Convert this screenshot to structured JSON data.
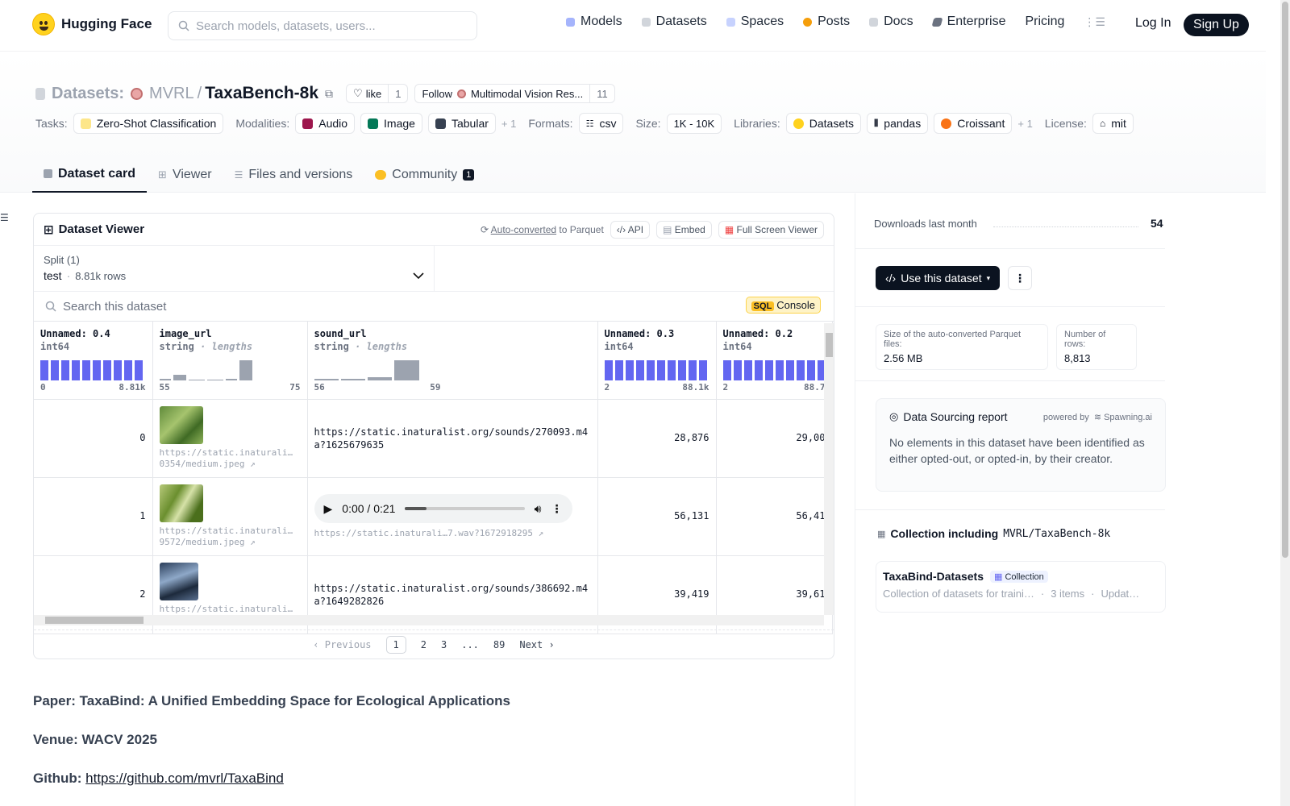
{
  "nav": {
    "brand": "Hugging Face",
    "search_placeholder": "Search models, datasets, users...",
    "items": [
      "Models",
      "Datasets",
      "Spaces",
      "Posts",
      "Docs",
      "Enterprise",
      "Pricing"
    ],
    "login": "Log In",
    "signup": "Sign Up"
  },
  "header": {
    "section": "Datasets:",
    "org": "MVRL",
    "slash": "/",
    "name": "TaxaBench-8k",
    "like_label": "like",
    "like_count": "1",
    "follow_label": "Follow",
    "follow_org": "Multimodal Vision Res...",
    "follow_count": "11",
    "tasks_label": "Tasks:",
    "task": "Zero-Shot Classification",
    "modalities_label": "Modalities:",
    "modalities": [
      "Audio",
      "Image",
      "Tabular"
    ],
    "modalities_more": "+ 1",
    "formats_label": "Formats:",
    "format": "csv",
    "size_label": "Size:",
    "size": "1K - 10K",
    "libraries_label": "Libraries:",
    "libraries": [
      "Datasets",
      "pandas",
      "Croissant"
    ],
    "libraries_more": "+ 1",
    "license_label": "License:",
    "license": "mit"
  },
  "tabs": [
    {
      "label": "Dataset card",
      "active": true
    },
    {
      "label": "Viewer"
    },
    {
      "label": "Files and versions"
    },
    {
      "label": "Community",
      "badge": "1"
    }
  ],
  "viewer": {
    "title": "Dataset Viewer",
    "auto_converted": "Auto-converted",
    "to_parquet": "to Parquet",
    "api": "API",
    "embed": "Embed",
    "full_screen": "Full Screen Viewer",
    "split_label": "Split (1)",
    "split_name": "test",
    "split_dot": "·",
    "split_rows": "8.81k rows",
    "search_placeholder": "Search this dataset",
    "sql": "SQL",
    "console": "Console",
    "columns": [
      {
        "name": "Unnamed: 0.4",
        "type": "int64",
        "min": "0",
        "max": "8.81k"
      },
      {
        "name": "image_url",
        "type": "string",
        "sub": "· lengths",
        "min": "55",
        "max": "75"
      },
      {
        "name": "sound_url",
        "type": "string",
        "sub": "· lengths",
        "min": "56",
        "max": "59"
      },
      {
        "name": "Unnamed: 0.3",
        "type": "int64",
        "min": "2",
        "max": "88.1k"
      },
      {
        "name": "Unnamed: 0.2",
        "type": "int64",
        "min": "2",
        "max": "88.7"
      }
    ],
    "rows": [
      {
        "idx": "0",
        "img_url_a": "https://static.inaturali…",
        "img_url_b": "0354/medium.jpeg ↗",
        "sound": "https://static.inaturalist.org/sounds/270093.m4a?1625679635",
        "c3": "28,876",
        "c4": "29,00"
      },
      {
        "idx": "1",
        "img_url_a": "https://static.inaturali…",
        "img_url_b": "9572/medium.jpeg ↗",
        "audio_time": "0:00 / 0:21",
        "sound_small": "https://static.inaturali…7.wav?1672918295 ↗",
        "c3": "56,131",
        "c4": "56,41"
      },
      {
        "idx": "2",
        "img_url_a": "https://static.inaturali…",
        "img_url_b": "",
        "sound": "https://static.inaturalist.org/sounds/386692.m4a?1649282826",
        "c3": "39,419",
        "c4": "39,61"
      }
    ],
    "pager": {
      "prev": "‹ Previous",
      "pages": [
        "1",
        "2",
        "3",
        "...",
        "89"
      ],
      "next": "Next ›"
    }
  },
  "card": {
    "paper": "Paper: TaxaBind: A Unified Embedding Space for Ecological Applications",
    "venue": "Venue: WACV 2025",
    "github_label": "Github:",
    "github_url": "https://github.com/mvrl/TaxaBind"
  },
  "side": {
    "downloads_label": "Downloads last month",
    "downloads": "54",
    "use_dataset": "Use this dataset",
    "parquet_label": "Size of the auto-converted Parquet files:",
    "parquet_value": "2.56 MB",
    "rows_label": "Number of rows:",
    "rows_value": "8,813",
    "sourcing_title": "Data Sourcing report",
    "powered_by": "powered by",
    "spawning": "Spawning.ai",
    "sourcing_text": "No elements in this dataset have been identified as either opted-out, or opted-in, by their creator.",
    "collection_prefix": "Collection including",
    "collection_repo": "MVRL/TaxaBench-8k",
    "collection_name": "TaxaBind-Datasets",
    "collection_badge": "Collection",
    "collection_desc": "Collection of datasets for traini…",
    "collection_items": "3 items",
    "collection_updated": "Updat…"
  },
  "colors": {
    "accent": "#6366f1",
    "dark": "#0b1320",
    "brand": "#ffd21e"
  }
}
